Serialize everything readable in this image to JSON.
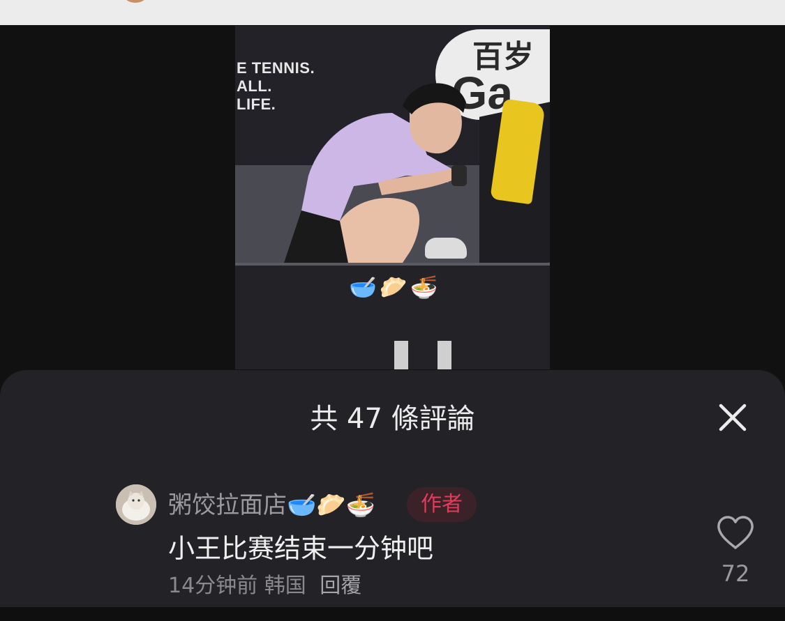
{
  "post": {
    "banner_text": "E TENNIS.\nALL.\nLIFE.",
    "logo_text": "百岁",
    "logo_mark": "Ga",
    "emoji_caption": "🥣🥟🍜"
  },
  "comments_panel": {
    "title": "共 47 條評論",
    "close_icon": "close-icon",
    "comments": [
      {
        "username": "粥饺拉面店🥣🥟🍜",
        "author_badge": "作者",
        "text": "小王比赛结束一分钟吧",
        "time": "14分钟前",
        "location": "韩国",
        "reply_label": "回覆",
        "like_count": "72",
        "like_icon": "heart-outline-icon"
      }
    ]
  },
  "colors": {
    "sheet_bg": "#232327",
    "author_badge_text": "#e23a5a",
    "author_badge_bg": "#3a2228",
    "username": "#9b9b9f"
  }
}
